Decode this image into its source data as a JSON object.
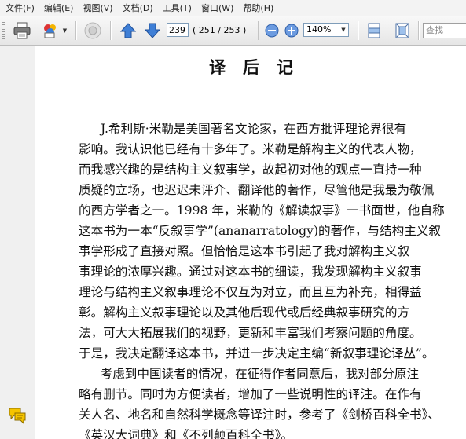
{
  "menu": [
    "文件(F)",
    "编辑(E)",
    "视图(V)",
    "文档(D)",
    "工具(T)",
    "窗口(W)",
    "帮助(H)"
  ],
  "toolbar": {
    "current_page": "239",
    "page_count": "( 251 / 253 )",
    "zoom": "140%",
    "search_placeholder": "查找"
  },
  "document": {
    "title": "译后记",
    "lines": [
      "J.希利斯·米勒是美国著名文论家，在西方批评理论界很有",
      "影响。我认识他已经有十多年了。米勒是解构主义的代表人物，",
      "而我感兴趣的是结构主义叙事学，故起初对他的观点一直持一种",
      "质疑的立场，也迟迟未评介、翻译他的著作，尽管他是我最为敬佩",
      "的西方学者之一。1998 年，米勒的《解读叙事》一书面世，他自称",
      "这本书为一本“反叙事学”(ananarratology)的著作，与结构主义叙",
      "事学形成了直接对照。但恰恰是这本书引起了我对解构主义叙",
      "事理论的浓厚兴趣。通过对这本书的细读，我发现解构主义叙事",
      "理论与结构主义叙事理论不仅互为对立，而且互为补充，相得益",
      "彰。解构主义叙事理论以及其他后现代或后经典叙事研究的方",
      "法，可大大拓展我们的视野，更新和丰富我们考察问题的角度。",
      "于是，我决定翻译这本书，并进一步决定主编“新叙事理论译丛”。",
      "　考虑到中国读者的情况，在征得作者同意后，我对部分原注",
      "略有删节。同时为方便读者，增加了一些说明性的译注。在作有",
      "关人名、地名和自然科学概念等译注时，参考了《剑桥百科全书》、",
      "《英汉大词典》和《不列颠百科全书》。"
    ]
  }
}
